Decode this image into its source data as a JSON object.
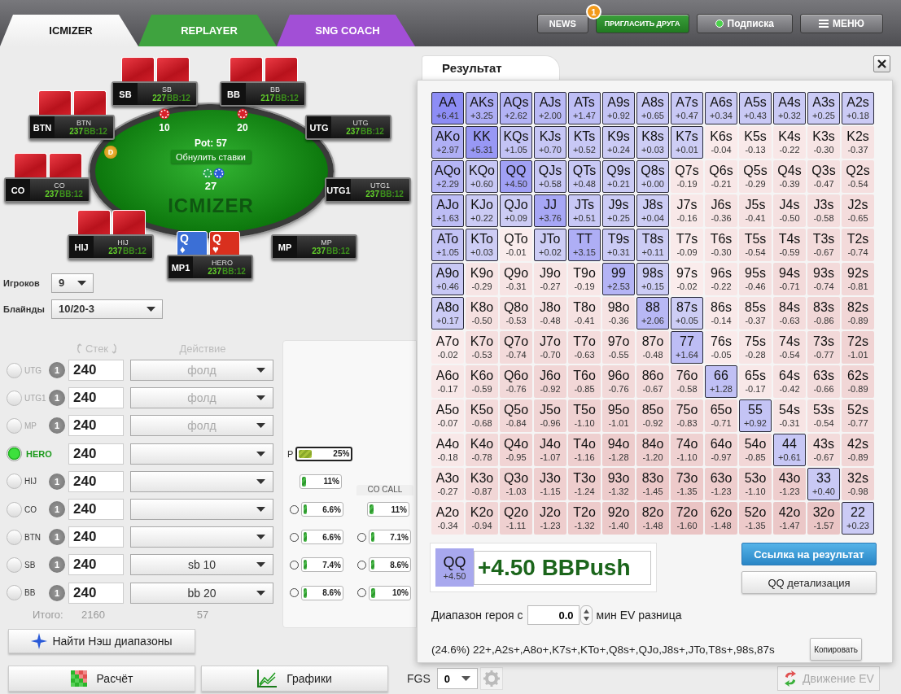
{
  "nav": {
    "tabs": [
      {
        "label": "ICMIZER",
        "selected": true,
        "color": "#ececec"
      },
      {
        "label": "REPLAYER",
        "selected": false,
        "color": "#3fa33f"
      },
      {
        "label": "SNG COACH",
        "selected": false,
        "color": "#a24fd6"
      }
    ],
    "buttons": [
      {
        "kind": "plain",
        "label": "NEWS"
      },
      {
        "kind": "invite",
        "label": "ПРИГЛАСИТЬ ДРУГА",
        "badge": "1"
      },
      {
        "kind": "status",
        "label": "Подписка"
      },
      {
        "kind": "menu",
        "label": "МЕНЮ"
      }
    ]
  },
  "table": {
    "seats": [
      {
        "kind": "hidden_cards",
        "position": "SB",
        "name": "SB",
        "stack": "227",
        "bb": "BB:12"
      },
      {
        "kind": "hidden_cards",
        "position": "BB",
        "name": "BB",
        "stack": "217",
        "bb": "BB:12"
      },
      {
        "kind": "hidden_cards",
        "position": "BTN",
        "name": "BTN",
        "stack": "237",
        "bb": "BB:12"
      },
      {
        "kind": "no_cards",
        "position": "UTG",
        "name": "UTG",
        "stack": "237",
        "bb": "BB:12"
      },
      {
        "kind": "hidden_cards",
        "position": "CO",
        "name": "CO",
        "stack": "237",
        "bb": "BB:12"
      },
      {
        "kind": "no_cards",
        "position": "UTG1",
        "name": "UTG1",
        "stack": "237",
        "bb": "BB:12"
      },
      {
        "kind": "hidden_cards",
        "position": "HIJ",
        "name": "HIJ",
        "stack": "237",
        "bb": "BB:12"
      },
      {
        "kind": "no_cards",
        "position": "MP",
        "name": "MP",
        "stack": "237",
        "bb": "BB:12"
      },
      {
        "kind": "hero",
        "position": "MP1",
        "name": "HERO",
        "stack": "237",
        "bb": "BB:12",
        "cards": [
          {
            "rank": "Q",
            "suit": "♦",
            "color": "#3b6fd6"
          },
          {
            "rank": "Q",
            "suit": "♥",
            "color": "#d9301e"
          }
        ]
      }
    ],
    "bets": [
      {
        "amount": "10"
      },
      {
        "amount": "20"
      }
    ],
    "dealer": "D",
    "pot": "Pot: 57",
    "reset_button": "Обнулить ставки",
    "felt_logo": "ICMIZER",
    "center_bet": "27"
  },
  "controls": {
    "players_label": "Игроков",
    "players_value": "9",
    "blinds_label": "Блайнды",
    "blinds_value": "10/20-3",
    "stack_header": "Стек",
    "action_header": "Действие",
    "players": [
      {
        "name": "UTG",
        "badge": "1",
        "stack": "240",
        "action": "фолд",
        "selected": false,
        "disabled": true
      },
      {
        "name": "UTG1",
        "badge": "1",
        "stack": "240",
        "action": "фолд",
        "selected": false,
        "disabled": true
      },
      {
        "name": "MP",
        "badge": "1",
        "stack": "240",
        "action": "фолд",
        "selected": false,
        "disabled": true
      },
      {
        "name": "HERO",
        "stack": "240",
        "selected": true,
        "disabled": false
      },
      {
        "name": "HIJ",
        "badge": "1",
        "stack": "240",
        "selected": false,
        "disabled": false
      },
      {
        "name": "CO",
        "badge": "1",
        "stack": "240",
        "selected": false,
        "disabled": false
      },
      {
        "name": "BTN",
        "badge": "1",
        "stack": "240",
        "selected": false,
        "disabled": false
      },
      {
        "name": "SB",
        "badge": "1",
        "stack": "240",
        "action": "sb 10",
        "selected": false,
        "disabled": false
      },
      {
        "name": "BB",
        "badge": "1",
        "stack": "240",
        "action": "bb 20",
        "selected": false,
        "disabled": false
      }
    ],
    "total_label": "Итого:",
    "total_stack": "2160",
    "total_bets": "57",
    "nash_button": "Найти Нэш диапазоны"
  },
  "range_panel": {
    "push": {
      "label": "P",
      "reading": "25%",
      "level": 0.25
    },
    "columns": [
      {
        "bars": [
          {
            "kind": "plain",
            "reading": "11%",
            "level": 0.11
          },
          {
            "kind": "radio",
            "reading": "6.6%",
            "level": 0.066,
            "selected": false
          },
          {
            "kind": "radio",
            "reading": "6.6%",
            "level": 0.066,
            "selected": false
          },
          {
            "kind": "radio",
            "reading": "7.4%",
            "level": 0.074,
            "selected": false
          },
          {
            "kind": "radio",
            "reading": "8.6%",
            "level": 0.086,
            "selected": false
          }
        ]
      },
      {
        "title": "CO CALL",
        "bars": [
          {
            "kind": "plain",
            "reading": "11%",
            "level": 0.11
          },
          {
            "kind": "radio",
            "reading": "7.1%",
            "level": 0.071,
            "selected": false
          },
          {
            "kind": "radio",
            "reading": "8.6%",
            "level": 0.086,
            "selected": false
          },
          {
            "kind": "radio",
            "reading": "10%",
            "level": 0.1,
            "selected": false
          }
        ]
      }
    ]
  },
  "result": {
    "tab": "Результат",
    "matrix": [
      [
        {
          "hand": "AA",
          "ev": "+6.41",
          "selected": true
        },
        {
          "hand": "AKs",
          "ev": "+3.25",
          "selected": true
        },
        {
          "hand": "AQs",
          "ev": "+2.62",
          "selected": true
        },
        {
          "hand": "AJs",
          "ev": "+2.00",
          "selected": true
        },
        {
          "hand": "ATs",
          "ev": "+1.47",
          "selected": true
        },
        {
          "hand": "A9s",
          "ev": "+0.92",
          "selected": true
        },
        {
          "hand": "A8s",
          "ev": "+0.65",
          "selected": true
        },
        {
          "hand": "A7s",
          "ev": "+0.47",
          "selected": true
        },
        {
          "hand": "A6s",
          "ev": "+0.34",
          "selected": true
        },
        {
          "hand": "A5s",
          "ev": "+0.43",
          "selected": true
        },
        {
          "hand": "A4s",
          "ev": "+0.32",
          "selected": true
        },
        {
          "hand": "A3s",
          "ev": "+0.25",
          "selected": true
        },
        {
          "hand": "A2s",
          "ev": "+0.18",
          "selected": true
        }
      ],
      [
        {
          "hand": "AKo",
          "ev": "+2.97",
          "selected": true
        },
        {
          "hand": "KK",
          "ev": "+5.31",
          "selected": true
        },
        {
          "hand": "KQs",
          "ev": "+1.05",
          "selected": true
        },
        {
          "hand": "KJs",
          "ev": "+0.70",
          "selected": true
        },
        {
          "hand": "KTs",
          "ev": "+0.52",
          "selected": true
        },
        {
          "hand": "K9s",
          "ev": "+0.24",
          "selected": true
        },
        {
          "hand": "K8s",
          "ev": "+0.03",
          "selected": true
        },
        {
          "hand": "K7s",
          "ev": "+0.01",
          "selected": true
        },
        {
          "hand": "K6s",
          "ev": "-0.04",
          "selected": false
        },
        {
          "hand": "K5s",
          "ev": "-0.13",
          "selected": false
        },
        {
          "hand": "K4s",
          "ev": "-0.22",
          "selected": false
        },
        {
          "hand": "K3s",
          "ev": "-0.30",
          "selected": false
        },
        {
          "hand": "K2s",
          "ev": "-0.37",
          "selected": false
        }
      ],
      [
        {
          "hand": "AQo",
          "ev": "+2.29",
          "selected": true
        },
        {
          "hand": "KQo",
          "ev": "+0.60",
          "selected": true
        },
        {
          "hand": "QQ",
          "ev": "+4.50",
          "selected": true
        },
        {
          "hand": "QJs",
          "ev": "+0.58",
          "selected": true
        },
        {
          "hand": "QTs",
          "ev": "+0.48",
          "selected": true
        },
        {
          "hand": "Q9s",
          "ev": "+0.21",
          "selected": true
        },
        {
          "hand": "Q8s",
          "ev": "+0.00",
          "selected": true
        },
        {
          "hand": "Q7s",
          "ev": "-0.19",
          "selected": false
        },
        {
          "hand": "Q6s",
          "ev": "-0.21",
          "selected": false
        },
        {
          "hand": "Q5s",
          "ev": "-0.29",
          "selected": false
        },
        {
          "hand": "Q4s",
          "ev": "-0.39",
          "selected": false
        },
        {
          "hand": "Q3s",
          "ev": "-0.47",
          "selected": false
        },
        {
          "hand": "Q2s",
          "ev": "-0.54",
          "selected": false
        }
      ],
      [
        {
          "hand": "AJo",
          "ev": "+1.63",
          "selected": true
        },
        {
          "hand": "KJo",
          "ev": "+0.22",
          "selected": true
        },
        {
          "hand": "QJo",
          "ev": "+0.09",
          "selected": true
        },
        {
          "hand": "JJ",
          "ev": "+3.76",
          "selected": true
        },
        {
          "hand": "JTs",
          "ev": "+0.51",
          "selected": true
        },
        {
          "hand": "J9s",
          "ev": "+0.25",
          "selected": true
        },
        {
          "hand": "J8s",
          "ev": "+0.04",
          "selected": true
        },
        {
          "hand": "J7s",
          "ev": "-0.16",
          "selected": false
        },
        {
          "hand": "J6s",
          "ev": "-0.36",
          "selected": false
        },
        {
          "hand": "J5s",
          "ev": "-0.41",
          "selected": false
        },
        {
          "hand": "J4s",
          "ev": "-0.50",
          "selected": false
        },
        {
          "hand": "J3s",
          "ev": "-0.58",
          "selected": false
        },
        {
          "hand": "J2s",
          "ev": "-0.65",
          "selected": false
        }
      ],
      [
        {
          "hand": "ATo",
          "ev": "+1.05",
          "selected": true
        },
        {
          "hand": "KTo",
          "ev": "+0.03",
          "selected": true
        },
        {
          "hand": "QTo",
          "ev": "-0.01",
          "selected": false
        },
        {
          "hand": "JTo",
          "ev": "+0.02",
          "selected": true
        },
        {
          "hand": "TT",
          "ev": "+3.15",
          "selected": true
        },
        {
          "hand": "T9s",
          "ev": "+0.31",
          "selected": true
        },
        {
          "hand": "T8s",
          "ev": "+0.11",
          "selected": true
        },
        {
          "hand": "T7s",
          "ev": "-0.09",
          "selected": false
        },
        {
          "hand": "T6s",
          "ev": "-0.30",
          "selected": false
        },
        {
          "hand": "T5s",
          "ev": "-0.54",
          "selected": false
        },
        {
          "hand": "T4s",
          "ev": "-0.59",
          "selected": false
        },
        {
          "hand": "T3s",
          "ev": "-0.67",
          "selected": false
        },
        {
          "hand": "T2s",
          "ev": "-0.74",
          "selected": false
        }
      ],
      [
        {
          "hand": "A9o",
          "ev": "+0.46",
          "selected": true
        },
        {
          "hand": "K9o",
          "ev": "-0.29",
          "selected": false
        },
        {
          "hand": "Q9o",
          "ev": "-0.31",
          "selected": false
        },
        {
          "hand": "J9o",
          "ev": "-0.27",
          "selected": false
        },
        {
          "hand": "T9o",
          "ev": "-0.19",
          "selected": false
        },
        {
          "hand": "99",
          "ev": "+2.53",
          "selected": true
        },
        {
          "hand": "98s",
          "ev": "+0.15",
          "selected": true
        },
        {
          "hand": "97s",
          "ev": "-0.02",
          "selected": false
        },
        {
          "hand": "96s",
          "ev": "-0.22",
          "selected": false
        },
        {
          "hand": "95s",
          "ev": "-0.46",
          "selected": false
        },
        {
          "hand": "94s",
          "ev": "-0.71",
          "selected": false
        },
        {
          "hand": "93s",
          "ev": "-0.74",
          "selected": false
        },
        {
          "hand": "92s",
          "ev": "-0.81",
          "selected": false
        }
      ],
      [
        {
          "hand": "A8o",
          "ev": "+0.17",
          "selected": true
        },
        {
          "hand": "K8o",
          "ev": "-0.50",
          "selected": false
        },
        {
          "hand": "Q8o",
          "ev": "-0.53",
          "selected": false
        },
        {
          "hand": "J8o",
          "ev": "-0.48",
          "selected": false
        },
        {
          "hand": "T8o",
          "ev": "-0.41",
          "selected": false
        },
        {
          "hand": "98o",
          "ev": "-0.36",
          "selected": false
        },
        {
          "hand": "88",
          "ev": "+2.06",
          "selected": true
        },
        {
          "hand": "87s",
          "ev": "+0.05",
          "selected": true
        },
        {
          "hand": "86s",
          "ev": "-0.14",
          "selected": false
        },
        {
          "hand": "85s",
          "ev": "-0.37",
          "selected": false
        },
        {
          "hand": "84s",
          "ev": "-0.63",
          "selected": false
        },
        {
          "hand": "83s",
          "ev": "-0.86",
          "selected": false
        },
        {
          "hand": "82s",
          "ev": "-0.89",
          "selected": false
        }
      ],
      [
        {
          "hand": "A7o",
          "ev": "-0.02",
          "selected": false
        },
        {
          "hand": "K7o",
          "ev": "-0.53",
          "selected": false
        },
        {
          "hand": "Q7o",
          "ev": "-0.74",
          "selected": false
        },
        {
          "hand": "J7o",
          "ev": "-0.70",
          "selected": false
        },
        {
          "hand": "T7o",
          "ev": "-0.63",
          "selected": false
        },
        {
          "hand": "97o",
          "ev": "-0.55",
          "selected": false
        },
        {
          "hand": "87o",
          "ev": "-0.48",
          "selected": false
        },
        {
          "hand": "77",
          "ev": "+1.64",
          "selected": true
        },
        {
          "hand": "76s",
          "ev": "-0.05",
          "selected": false
        },
        {
          "hand": "75s",
          "ev": "-0.28",
          "selected": false
        },
        {
          "hand": "74s",
          "ev": "-0.54",
          "selected": false
        },
        {
          "hand": "73s",
          "ev": "-0.77",
          "selected": false
        },
        {
          "hand": "72s",
          "ev": "-1.01",
          "selected": false
        }
      ],
      [
        {
          "hand": "A6o",
          "ev": "-0.17",
          "selected": false
        },
        {
          "hand": "K6o",
          "ev": "-0.59",
          "selected": false
        },
        {
          "hand": "Q6o",
          "ev": "-0.76",
          "selected": false
        },
        {
          "hand": "J6o",
          "ev": "-0.92",
          "selected": false
        },
        {
          "hand": "T6o",
          "ev": "-0.85",
          "selected": false
        },
        {
          "hand": "96o",
          "ev": "-0.76",
          "selected": false
        },
        {
          "hand": "86o",
          "ev": "-0.67",
          "selected": false
        },
        {
          "hand": "76o",
          "ev": "-0.58",
          "selected": false
        },
        {
          "hand": "66",
          "ev": "+1.28",
          "selected": true
        },
        {
          "hand": "65s",
          "ev": "-0.17",
          "selected": false
        },
        {
          "hand": "64s",
          "ev": "-0.42",
          "selected": false
        },
        {
          "hand": "63s",
          "ev": "-0.66",
          "selected": false
        },
        {
          "hand": "62s",
          "ev": "-0.89",
          "selected": false
        }
      ],
      [
        {
          "hand": "A5o",
          "ev": "-0.07",
          "selected": false
        },
        {
          "hand": "K5o",
          "ev": "-0.68",
          "selected": false
        },
        {
          "hand": "Q5o",
          "ev": "-0.84",
          "selected": false
        },
        {
          "hand": "J5o",
          "ev": "-0.96",
          "selected": false
        },
        {
          "hand": "T5o",
          "ev": "-1.10",
          "selected": false
        },
        {
          "hand": "95o",
          "ev": "-1.01",
          "selected": false
        },
        {
          "hand": "85o",
          "ev": "-0.92",
          "selected": false
        },
        {
          "hand": "75o",
          "ev": "-0.83",
          "selected": false
        },
        {
          "hand": "65o",
          "ev": "-0.71",
          "selected": false
        },
        {
          "hand": "55",
          "ev": "+0.92",
          "selected": true
        },
        {
          "hand": "54s",
          "ev": "-0.31",
          "selected": false
        },
        {
          "hand": "53s",
          "ev": "-0.54",
          "selected": false
        },
        {
          "hand": "52s",
          "ev": "-0.77",
          "selected": false
        }
      ],
      [
        {
          "hand": "A4o",
          "ev": "-0.18",
          "selected": false
        },
        {
          "hand": "K4o",
          "ev": "-0.78",
          "selected": false
        },
        {
          "hand": "Q4o",
          "ev": "-0.95",
          "selected": false
        },
        {
          "hand": "J4o",
          "ev": "-1.07",
          "selected": false
        },
        {
          "hand": "T4o",
          "ev": "-1.16",
          "selected": false
        },
        {
          "hand": "94o",
          "ev": "-1.28",
          "selected": false
        },
        {
          "hand": "84o",
          "ev": "-1.20",
          "selected": false
        },
        {
          "hand": "74o",
          "ev": "-1.10",
          "selected": false
        },
        {
          "hand": "64o",
          "ev": "-0.97",
          "selected": false
        },
        {
          "hand": "54o",
          "ev": "-0.85",
          "selected": false
        },
        {
          "hand": "44",
          "ev": "+0.61",
          "selected": true
        },
        {
          "hand": "43s",
          "ev": "-0.67",
          "selected": false
        },
        {
          "hand": "42s",
          "ev": "-0.89",
          "selected": false
        }
      ],
      [
        {
          "hand": "A3o",
          "ev": "-0.27",
          "selected": false
        },
        {
          "hand": "K3o",
          "ev": "-0.87",
          "selected": false
        },
        {
          "hand": "Q3o",
          "ev": "-1.03",
          "selected": false
        },
        {
          "hand": "J3o",
          "ev": "-1.15",
          "selected": false
        },
        {
          "hand": "T3o",
          "ev": "-1.24",
          "selected": false
        },
        {
          "hand": "93o",
          "ev": "-1.32",
          "selected": false
        },
        {
          "hand": "83o",
          "ev": "-1.45",
          "selected": false
        },
        {
          "hand": "73o",
          "ev": "-1.35",
          "selected": false
        },
        {
          "hand": "63o",
          "ev": "-1.23",
          "selected": false
        },
        {
          "hand": "53o",
          "ev": "-1.10",
          "selected": false
        },
        {
          "hand": "43o",
          "ev": "-1.23",
          "selected": false
        },
        {
          "hand": "33",
          "ev": "+0.40",
          "selected": true
        },
        {
          "hand": "32s",
          "ev": "-0.98",
          "selected": false
        }
      ],
      [
        {
          "hand": "A2o",
          "ev": "-0.34",
          "selected": false
        },
        {
          "hand": "K2o",
          "ev": "-0.94",
          "selected": false
        },
        {
          "hand": "Q2o",
          "ev": "-1.11",
          "selected": false
        },
        {
          "hand": "J2o",
          "ev": "-1.23",
          "selected": false
        },
        {
          "hand": "T2o",
          "ev": "-1.32",
          "selected": false
        },
        {
          "hand": "92o",
          "ev": "-1.40",
          "selected": false
        },
        {
          "hand": "82o",
          "ev": "-1.48",
          "selected": false
        },
        {
          "hand": "72o",
          "ev": "-1.60",
          "selected": false
        },
        {
          "hand": "62o",
          "ev": "-1.48",
          "selected": false
        },
        {
          "hand": "52o",
          "ev": "-1.35",
          "selected": false
        },
        {
          "hand": "42o",
          "ev": "-1.47",
          "selected": false
        },
        {
          "hand": "32o",
          "ev": "-1.57",
          "selected": false
        },
        {
          "hand": "22",
          "ev": "+0.23",
          "selected": true
        }
      ]
    ],
    "summary": {
      "hand": "QQ",
      "ev": "+4.50",
      "result": "+4.50 BBPush"
    },
    "link_button": "Ссылка на результат",
    "detail_button": "QQ детализация",
    "range_filter": {
      "label": "Диапазон героя с",
      "value": "0.0",
      "unit": "мин EV разница"
    },
    "range_text": "(24.6%) 22+,A2s+,A8o+,K7s+,KTo+,Q8s+,QJo,J8s+,JTo,T8s+,98s,87s",
    "copy_button": "Копировать"
  },
  "bottom_bar": {
    "calc_button": "Расчёт",
    "charts_button": "Графики",
    "fgs_label": "FGS",
    "fgs_value": "0",
    "ev_button": {
      "label": "Движение EV",
      "disabled": true
    }
  }
}
